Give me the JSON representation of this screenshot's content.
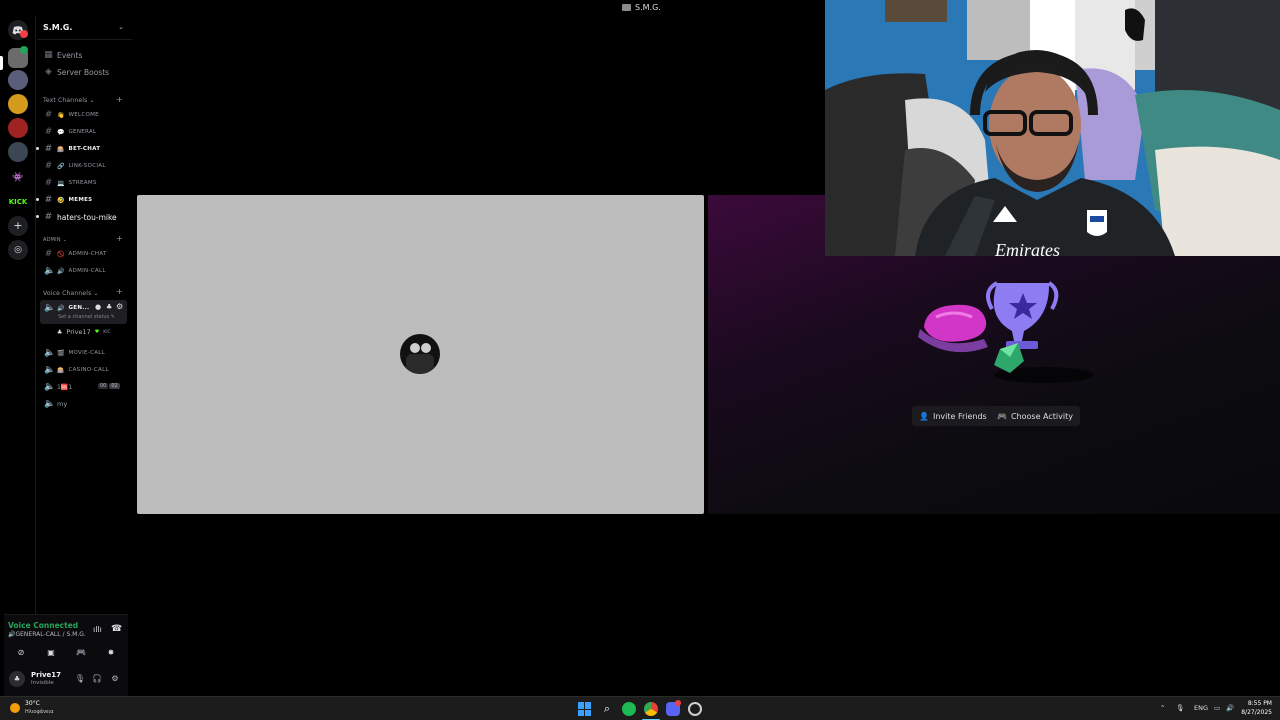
{
  "window": {
    "title": "S.M.G."
  },
  "server": {
    "name": "S.M.G.",
    "header_chevron": "chevron-down-icon",
    "top_items": [
      {
        "label": "Events",
        "icon": "calendar-icon"
      },
      {
        "label": "Server Boosts",
        "icon": "boost-icon"
      }
    ],
    "categories": {
      "text": "Text Channels",
      "admin": "ADMIN",
      "voice": "Voice Channels"
    },
    "text_channels": [
      {
        "emoji": "👋",
        "label": "WELCOME"
      },
      {
        "emoji": "💬",
        "label": "GENERAL"
      },
      {
        "emoji": "🎰",
        "label": "BET-CHAT"
      },
      {
        "emoji": "🔗",
        "label": "LINK-SOCIAL"
      },
      {
        "emoji": "💻",
        "label": "STREAMS"
      },
      {
        "emoji": "🤣",
        "label": "MEMES"
      },
      {
        "emoji": "",
        "label": "haters-tou-mike"
      }
    ],
    "admin_channels": [
      {
        "emoji": "🚫",
        "label": "ADMIN-CHAT"
      },
      {
        "emoji": "🔊",
        "label": "ADMIN-CALL"
      }
    ],
    "voice_channels": [
      {
        "emoji": "🔊",
        "label": "GEN...",
        "status": "Set a channel status",
        "member": "Prive17"
      },
      {
        "emoji": "🎬",
        "label": "MOVIE-CALL"
      },
      {
        "emoji": "🎰",
        "label": "CASINO-CALL"
      },
      {
        "emoji": "1🆘1",
        "label": "",
        "counter_a": "00",
        "counter_b": "02"
      },
      {
        "emoji": "",
        "label": "my"
      }
    ]
  },
  "user_panel": {
    "voice_status": "Voice Connected",
    "voice_channel": "🔊GENERAL-CALL / S.M.G.",
    "username": "Prive17",
    "user_status": "Invisible"
  },
  "activity": {
    "invite_label": "Invite Friends",
    "choose_label": "Choose Activity"
  },
  "taskbar": {
    "weather_temp": "30°C",
    "weather_desc": "Ηλιοφάνεια",
    "lang": "ENG",
    "time": "8:55 PM",
    "date": "8/27/2025"
  },
  "colors": {
    "voice_green": "#23a559",
    "badge_red": "#f23f43",
    "stage_gray": "#bdbdbd",
    "activity_purple": "#3b0a3a"
  }
}
